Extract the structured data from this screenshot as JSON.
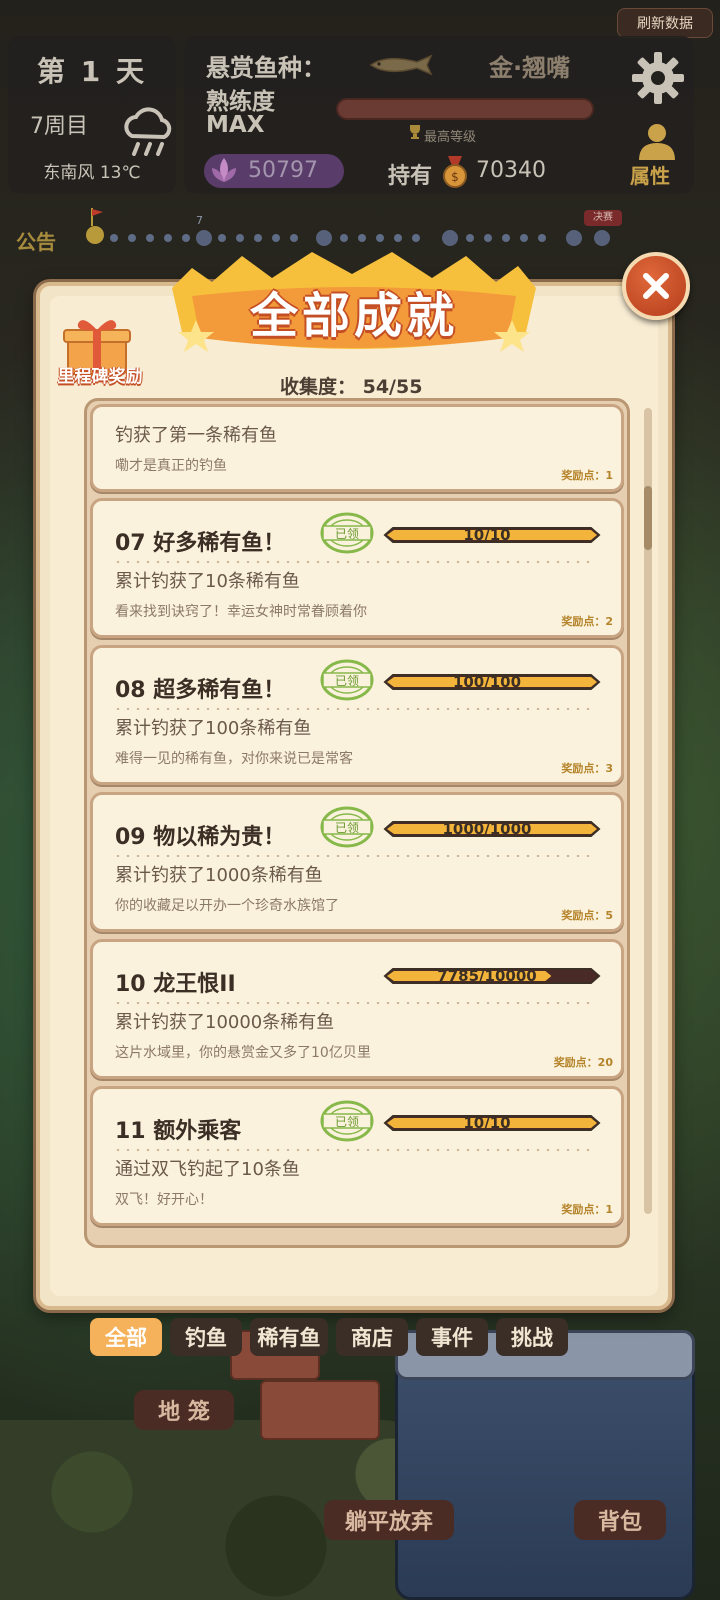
{
  "header": {
    "refresh_label": "刷新数据",
    "day_label": "第 1 天",
    "week_label": "7周目",
    "weather_icon": "cloud-rain-icon",
    "wind_label": "东南风 13℃",
    "bounty_label": "悬赏鱼种：",
    "bounty_fish": "金·翘嘴",
    "proficiency_label": "熟练度",
    "max_label": "MAX",
    "level_caption": "最高等级",
    "gem_value": "50797",
    "hold_label": "持有",
    "coin_value": "70340",
    "attr_label": "属性",
    "colors": {
      "panel": "#23211e",
      "accent_gold": "#c9a24a"
    }
  },
  "notice": {
    "label": "公告",
    "track_num": "7",
    "final_tag": "决赛"
  },
  "modal": {
    "title": "全部成就",
    "milestone_label": "里程碑奖励",
    "collect_text": "收集度：  54/55"
  },
  "achievements": [
    {
      "title": "",
      "desc": "钓获了第一条稀有鱼",
      "flavor": "嘞才是真正的钓鱼",
      "points": "奖励点：1",
      "progress": "",
      "claimed": false,
      "fill": 0
    },
    {
      "title": "07   好多稀有鱼！",
      "desc": "累计钓获了10条稀有鱼",
      "flavor": "看来找到诀窍了！幸运女神时常眷顾着你",
      "points": "奖励点：2",
      "progress": "10/10",
      "claimed": true,
      "fill": 1
    },
    {
      "title": "08   超多稀有鱼！",
      "desc": "累计钓获了100条稀有鱼",
      "flavor": "难得一见的稀有鱼，对你来说已是常客",
      "points": "奖励点：3",
      "progress": "100/100",
      "claimed": true,
      "fill": 1
    },
    {
      "title": "09   物以稀为贵！",
      "desc": "累计钓获了1000条稀有鱼",
      "flavor": "你的收藏足以开办一个珍奇水族馆了",
      "points": "奖励点：5",
      "progress": "1000/1000",
      "claimed": true,
      "fill": 1
    },
    {
      "title": "10   龙王恨II",
      "desc": "累计钓获了10000条稀有鱼",
      "flavor": "这片水域里，你的悬赏金又多了10亿贝里",
      "points": "奖励点：20",
      "progress": "7785/10000",
      "claimed": false,
      "fill": 0.7785
    },
    {
      "title": "11   额外乘客",
      "desc": "通过双飞钓起了10条鱼",
      "flavor": "双飞！好开心！",
      "points": "奖励点：1",
      "progress": "10/10",
      "claimed": true,
      "fill": 1
    }
  ],
  "stamp_text": "已领",
  "tabs": [
    "全部",
    "钓鱼",
    "稀有鱼",
    "商店",
    "事件",
    "挑战"
  ],
  "bottom": {
    "trap_label": "地 笼",
    "give_up_label": "躺平放弃",
    "bag_label": "背包"
  }
}
